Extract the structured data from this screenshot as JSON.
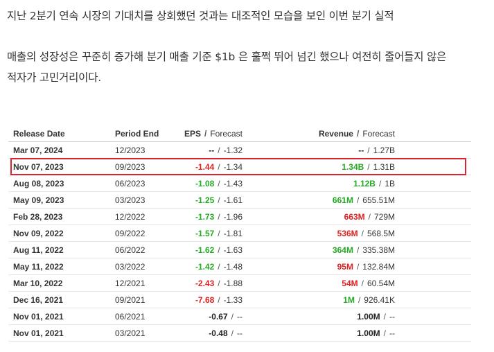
{
  "paragraphs": {
    "p1": "지난 2분기 연속 시장의 기대치를 상회했던 것과는 대조적인 모습을 보인 이번 분기 실적",
    "p2_line1": "매출의 성장성은 꾸준히 증가해 분기 매출 기준 $1b 은 훌쩍 뛰어 넘긴 했으나 여전히 줄어들지 않은",
    "p2_line2": "적자가 고민거리이다."
  },
  "table": {
    "headers": {
      "release_date": "Release Date",
      "period_end": "Period End",
      "eps": "EPS",
      "revenue": "Revenue",
      "forecast": "Forecast",
      "separator": "/"
    },
    "highlighted_row": 1,
    "rows": [
      {
        "release": "Mar 07, 2024",
        "period": "12/2023",
        "eps": "--",
        "eps_forecast": "-1.32",
        "eps_status": "neutral",
        "revenue": "--",
        "revenue_forecast": "1.27B",
        "revenue_status": "neutral"
      },
      {
        "release": "Nov 07, 2023",
        "period": "09/2023",
        "eps": "-1.44",
        "eps_forecast": "-1.34",
        "eps_status": "red",
        "revenue": "1.34B",
        "revenue_forecast": "1.31B",
        "revenue_status": "green"
      },
      {
        "release": "Aug 08, 2023",
        "period": "06/2023",
        "eps": "-1.08",
        "eps_forecast": "-1.43",
        "eps_status": "green",
        "revenue": "1.12B",
        "revenue_forecast": "1B",
        "revenue_status": "green"
      },
      {
        "release": "May 09, 2023",
        "period": "03/2023",
        "eps": "-1.25",
        "eps_forecast": "-1.61",
        "eps_status": "green",
        "revenue": "661M",
        "revenue_forecast": "655.51M",
        "revenue_status": "green"
      },
      {
        "release": "Feb 28, 2023",
        "period": "12/2022",
        "eps": "-1.73",
        "eps_forecast": "-1.96",
        "eps_status": "green",
        "revenue": "663M",
        "revenue_forecast": "729M",
        "revenue_status": "red"
      },
      {
        "release": "Nov 09, 2022",
        "period": "09/2022",
        "eps": "-1.57",
        "eps_forecast": "-1.81",
        "eps_status": "green",
        "revenue": "536M",
        "revenue_forecast": "568.5M",
        "revenue_status": "red"
      },
      {
        "release": "Aug 11, 2022",
        "period": "06/2022",
        "eps": "-1.62",
        "eps_forecast": "-1.63",
        "eps_status": "green",
        "revenue": "364M",
        "revenue_forecast": "335.38M",
        "revenue_status": "green"
      },
      {
        "release": "May 11, 2022",
        "period": "03/2022",
        "eps": "-1.42",
        "eps_forecast": "-1.48",
        "eps_status": "green",
        "revenue": "95M",
        "revenue_forecast": "132.84M",
        "revenue_status": "red"
      },
      {
        "release": "Mar 10, 2022",
        "period": "12/2021",
        "eps": "-2.43",
        "eps_forecast": "-1.88",
        "eps_status": "red",
        "revenue": "54M",
        "revenue_forecast": "60.54M",
        "revenue_status": "red"
      },
      {
        "release": "Dec 16, 2021",
        "period": "09/2021",
        "eps": "-7.68",
        "eps_forecast": "-1.33",
        "eps_status": "red",
        "revenue": "1M",
        "revenue_forecast": "926.41K",
        "revenue_status": "green"
      },
      {
        "release": "Nov 01, 2021",
        "period": "06/2021",
        "eps": "-0.67",
        "eps_forecast": "--",
        "eps_status": "neutral",
        "revenue": "1.00M",
        "revenue_forecast": "--",
        "revenue_status": "neutral"
      },
      {
        "release": "Nov 01, 2021",
        "period": "03/2021",
        "eps": "-0.48",
        "eps_forecast": "--",
        "eps_status": "neutral",
        "revenue": "1.00M",
        "revenue_forecast": "--",
        "revenue_status": "neutral"
      }
    ]
  },
  "colors": {
    "beat": "#22aa22",
    "miss": "#e02020",
    "highlight_border": "#d9252e"
  }
}
